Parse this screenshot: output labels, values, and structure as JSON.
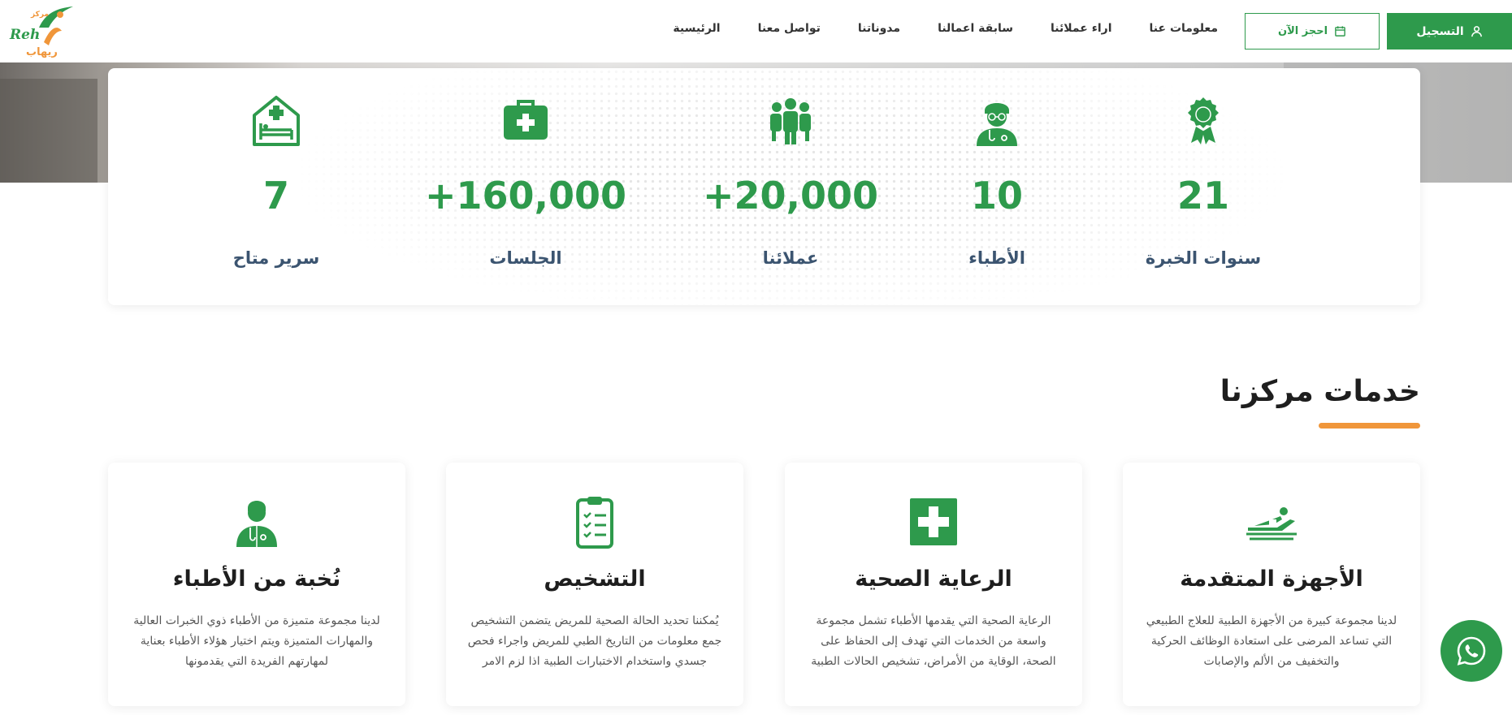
{
  "header": {
    "register_label": "التسجيل",
    "book_label": "احجز الآن",
    "logo_text": "Reh ريهاب",
    "logo_top": "مركز",
    "nav": [
      {
        "label": "الرئيسية"
      },
      {
        "label": "تواصل معنا"
      },
      {
        "label": "مدوناتنا"
      },
      {
        "label": "سابقة اعمالنا"
      },
      {
        "label": "اراء عملائنا"
      },
      {
        "label": "معلومات عنا"
      }
    ]
  },
  "stats": [
    {
      "value": "21",
      "label": "سنوات الخبرة",
      "icon": "award-ribbon-icon"
    },
    {
      "value": "10",
      "label": "الأطباء",
      "icon": "doctor-icon"
    },
    {
      "value": "+20,000",
      "label": "عملائنا",
      "icon": "group-users-icon"
    },
    {
      "value": "+160,000",
      "label": "الجلسات",
      "icon": "medical-kit-icon"
    },
    {
      "value": "7",
      "label": "سرير متاح",
      "icon": "hospital-bed-icon"
    }
  ],
  "services_section": {
    "title": "خدمات مركزنا"
  },
  "services": [
    {
      "title": "الأجهزة المتقدمة",
      "description": "لدينا مجموعة كبيرة من الأجهزة الطبية للعلاج الطبيعي التي تساعد المرضى على استعادة الوظائف الحركية والتخفيف من الألم والإصابات",
      "icon": "patient-bed-icon"
    },
    {
      "title": "الرعاية الصحية",
      "description": "الرعاية الصحية التي يقدمها الأطباء تشمل مجموعة واسعة من الخدمات التي تهدف إلى الحفاظ على الصحة، الوقاية من الأمراض، تشخيص الحالات الطبية",
      "icon": "medical-cross-icon"
    },
    {
      "title": "التشخيص",
      "description": "يُمكننا تحديد الحالة الصحية للمريض يتضمن التشخيص جمع معلومات من التاريخ الطبي للمريض واجراء فحص جسدي واستخدام الاختبارات الطبية اذا لزم الامر",
      "icon": "clipboard-checklist-icon"
    },
    {
      "title": "نُخبة من الأطباء",
      "description": "لدينا مجموعة متميزة من الأطباء ذوي الخبرات العالية والمهارات المتميزة ويتم اختيار هؤلاء الأطباء بعناية لمهارتهم الفريدة التي يقدمونها",
      "icon": "doctor-stethoscope-icon"
    }
  ],
  "colors": {
    "primary_green": "#2e9a4c",
    "accent_orange": "#f0963a",
    "label_navy": "#3b5470"
  }
}
